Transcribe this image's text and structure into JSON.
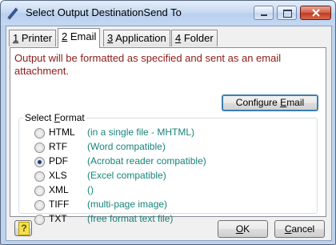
{
  "window": {
    "title": "Select Output DestinationSend To"
  },
  "tabs": [
    {
      "key": "1",
      "label": " Printer"
    },
    {
      "key": "2",
      "label": " Email"
    },
    {
      "key": "3",
      "label": " Application"
    },
    {
      "key": "4",
      "label": " Folder"
    }
  ],
  "active_tab": "2 Email",
  "email": {
    "info": "Output will be formatted as specified and sent as an email attachment.",
    "configure_button": {
      "pre": "Configure ",
      "key": "E",
      "post": "mail"
    }
  },
  "format_group": {
    "legend_pre": "Select ",
    "legend_key": "F",
    "legend_post": "ormat",
    "selected": "PDF",
    "options": [
      {
        "name": "HTML",
        "desc": "(in a single file - MHTML)"
      },
      {
        "name": "RTF",
        "desc": "(Word compatible)"
      },
      {
        "name": "PDF",
        "desc": "(Acrobat reader compatible)"
      },
      {
        "name": "XLS",
        "desc": "(Excel compatible)"
      },
      {
        "name": "XML",
        "desc": "()"
      },
      {
        "name": "TIFF",
        "desc": "(multi-page image)"
      },
      {
        "name": "TXT",
        "desc": "(free format text file)"
      }
    ]
  },
  "footer": {
    "help_glyph": "?",
    "ok": {
      "key": "O",
      "post": "K"
    },
    "cancel": {
      "key": "C",
      "post": "ancel"
    }
  },
  "colors": {
    "info_text": "#8b1a1a",
    "format_desc": "#16847a",
    "titlebar": "#c9dbf2"
  }
}
